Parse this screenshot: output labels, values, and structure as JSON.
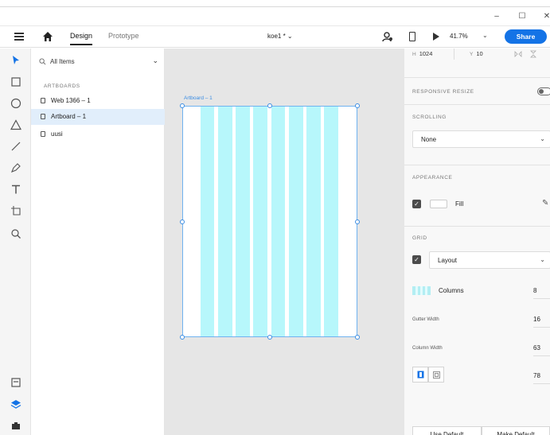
{
  "window": {
    "minimize_glyph": "–",
    "maximize_glyph": "☐",
    "close_glyph": "✕"
  },
  "toolbar": {
    "menu_icon": "hamburger-icon",
    "home_icon": "home-icon",
    "tabs": [
      {
        "label": "Design",
        "active": true
      },
      {
        "label": "Prototype",
        "active": false
      }
    ],
    "document_title": "koe1 * ⌄",
    "zoom": "41.7%",
    "zoom_caret": "⌄",
    "share_label": "Share",
    "accent": "#1473e6"
  },
  "tools": [
    {
      "name": "select-tool",
      "icon": "arrow-icon"
    },
    {
      "name": "rectangle-tool",
      "icon": "rectangle-icon"
    },
    {
      "name": "ellipse-tool",
      "icon": "ellipse-icon"
    },
    {
      "name": "triangle-tool",
      "icon": "triangle-icon"
    },
    {
      "name": "line-tool",
      "icon": "line-icon"
    },
    {
      "name": "pen-tool",
      "icon": "pen-icon"
    },
    {
      "name": "text-tool",
      "icon": "text-icon"
    },
    {
      "name": "artboard-tool",
      "icon": "artboard-icon"
    },
    {
      "name": "zoom-tool",
      "icon": "magnifier-icon"
    },
    {
      "name": "assets-tool",
      "icon": "assets-icon"
    },
    {
      "name": "layers-tool",
      "icon": "layers-icon"
    },
    {
      "name": "plugins-tool",
      "icon": "plugins-icon"
    }
  ],
  "layers": {
    "filter_label": "All Items",
    "section_label": "ARTBOARDS",
    "items": [
      {
        "label": "Web 1366 – 1",
        "selected": false
      },
      {
        "label": "Artboard – 1",
        "selected": true
      },
      {
        "label": "uusi",
        "selected": false
      }
    ]
  },
  "canvas": {
    "artboard_label": "Artboard – 1",
    "grid_color": "#b7f7fb",
    "columns": 8
  },
  "properties": {
    "h_label": "H",
    "h_value": "1024",
    "y_label": "Y",
    "y_value": "10",
    "responsive_resize_label": "RESPONSIVE RESIZE",
    "scrolling_label": "SCROLLING",
    "scrolling_value": "None",
    "appearance_label": "APPEARANCE",
    "fill_label": "Fill",
    "fill_checked": true,
    "grid_label": "GRID",
    "grid_type": "Layout",
    "grid_checked": true,
    "columns_label": "Columns",
    "columns_value": "8",
    "gutter_label": "Gutter Width",
    "gutter_value": "16",
    "column_width_label": "Column Width",
    "column_width_value": "63",
    "margin_value": "78",
    "use_default_label": "Use Default",
    "make_default_label": "Make Default"
  }
}
